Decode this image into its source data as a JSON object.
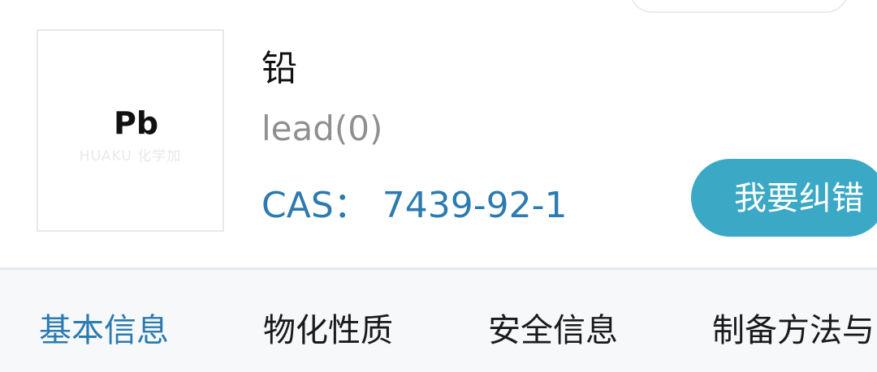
{
  "compound": {
    "formula": "Pb",
    "watermark": "HUAKU 化学加",
    "name_cn": "铅",
    "name_en": "lead(0)",
    "cas_label": "CAS：",
    "cas_number": "7439-92-1"
  },
  "actions": {
    "report_error_label": "我要纠错"
  },
  "tabs": [
    {
      "label": "基本信息",
      "active": true
    },
    {
      "label": "物化性质",
      "active": false
    },
    {
      "label": "安全信息",
      "active": false
    },
    {
      "label": "制备方法与",
      "active": false
    }
  ],
  "colors": {
    "accent_blue": "#2c7bb0",
    "button_teal": "#3ba9c6",
    "tabbar_bg": "#f6f8fa",
    "secondary_text": "#8f8f8f"
  }
}
